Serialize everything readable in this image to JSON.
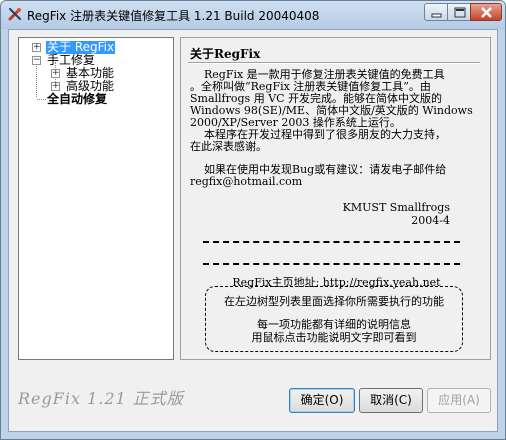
{
  "window": {
    "title": "RegFix 注册表关键值修复工具 1.21 Build 20040408"
  },
  "tree": {
    "items": [
      {
        "label": "关于 RegFix",
        "selected": true,
        "expander": "+"
      },
      {
        "label": "手工修复",
        "expander": "−"
      },
      {
        "label": "基本功能",
        "expander": "+"
      },
      {
        "label": "高级功能",
        "expander": "+"
      },
      {
        "label": "全自动修复"
      }
    ]
  },
  "panel": {
    "heading": "关于RegFix",
    "paragraph1": [
      "    RegFix 是一款用于修复注册表关键值的免费工具",
      "。全称叫做“RegFix 注册表关键值修复工具”。由",
      "Smallfrogs 用 VC 开发完成。能够在简体中文版的",
      "Windows 98(SE)/ME、简体中文版/英文版的 Windows",
      "2000/XP/Server 2003 操作系统上运行。",
      "    本程序在开发过程中得到了很多朋友的大力支持，",
      "在此深表感谢。"
    ],
    "paragraph2": [
      "    如果在使用中发现Bug或有建议：请发电子邮件给",
      "regfix@hotmail.com"
    ],
    "signature": "KMUST Smallfrogs",
    "date": "2004-4",
    "homepage": "RegFix主页地址: http://regfix.yeah.net",
    "hint": [
      "在左边树型列表里面选择你所需要执行的功能",
      "每一项功能都有详细的说明信息",
      "用鼠标点击功能说明文字即可看到"
    ]
  },
  "footer": {
    "version": "RegFix 1.21  正式版",
    "ok_label": "确定(O)",
    "cancel_label": "取消(C)",
    "apply_label": "应用(A)"
  },
  "colors": {
    "selection": "#3399ff",
    "frame": "#bcd3ea",
    "close_button": "#c4432a"
  },
  "icons": [
    "app-icon",
    "minimize-icon",
    "maximize-icon",
    "close-icon",
    "expand-icon",
    "collapse-icon"
  ]
}
